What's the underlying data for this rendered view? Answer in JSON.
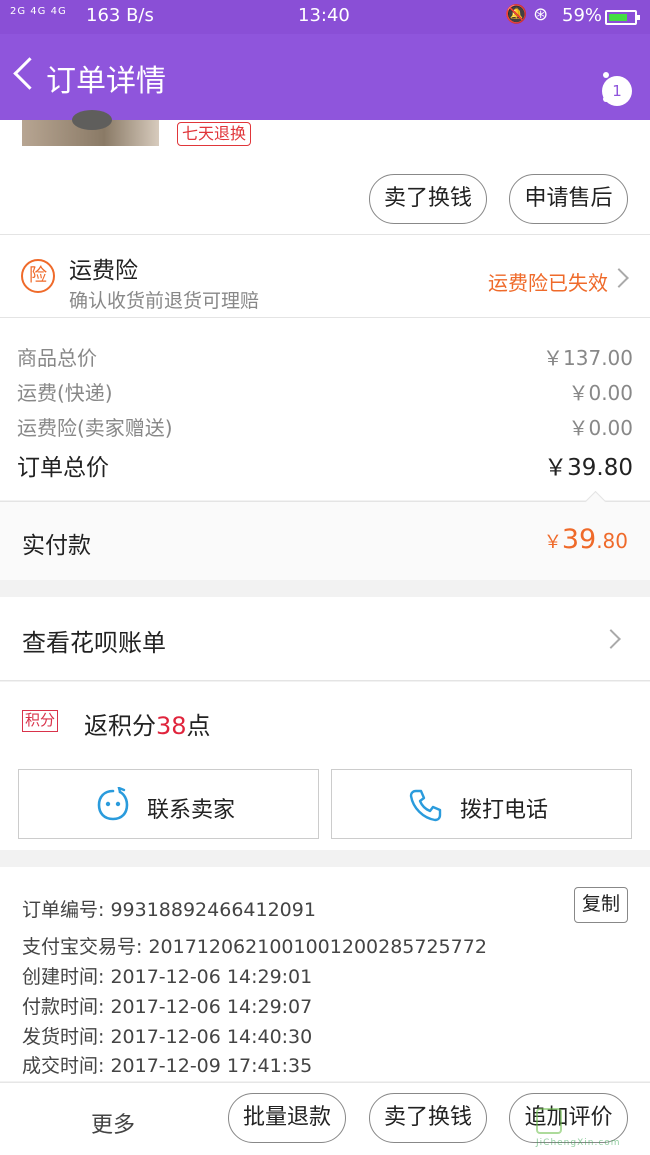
{
  "status_bar": {
    "signal": "2G 4G 4G",
    "speed": "163 B/s",
    "time": "13:40",
    "battery": "59%"
  },
  "header": {
    "title": "订单详情",
    "notification_count": "1"
  },
  "product": {
    "return_tag": "七天退换",
    "sell_button": "卖了换钱",
    "aftersale_button": "申请售后"
  },
  "insurance": {
    "icon_text": "险",
    "title": "运费险",
    "subtitle": "确认收货前退货可理赔",
    "status": "运费险已失效"
  },
  "prices": {
    "rows": [
      {
        "label": "商品总价",
        "value": "￥137.00"
      },
      {
        "label": "运费(快递)",
        "value": "￥0.00"
      },
      {
        "label": "运费险(卖家赠送)",
        "value": "￥0.00"
      }
    ],
    "total_label": "订单总价",
    "total_value": "￥39.80"
  },
  "paid": {
    "label": "实付款",
    "symbol": "￥",
    "integer": "39",
    "decimal": ".80"
  },
  "huabei": {
    "label": "查看花呗账单"
  },
  "points": {
    "tag": "积分",
    "prefix": "返积分",
    "number": "38",
    "suffix": "点"
  },
  "contact": {
    "seller_label": "联系卖家",
    "call_label": "拨打电话"
  },
  "order_info": {
    "copy_label": "复制",
    "rows": [
      "订单编号: 99318892466412091",
      "支付宝交易号: 2017120621001001200285725772",
      "创建时间: 2017-12-06 14:29:01",
      "付款时间: 2017-12-06 14:29:07",
      "发货时间: 2017-12-06 14:40:30",
      "成交时间: 2017-12-09 17:41:35"
    ]
  },
  "bottom_bar": {
    "more_label": "更多",
    "refund_label": "批量退款",
    "sell_label": "卖了换钱",
    "review_label": "追加评价"
  },
  "watermark": {
    "text": "JiChengXin.com"
  },
  "colors": {
    "header": "#8f55dc",
    "accent_orange": "#ef6a2a",
    "points_red": "#e0243c",
    "icon_blue": "#2a9bdc"
  }
}
